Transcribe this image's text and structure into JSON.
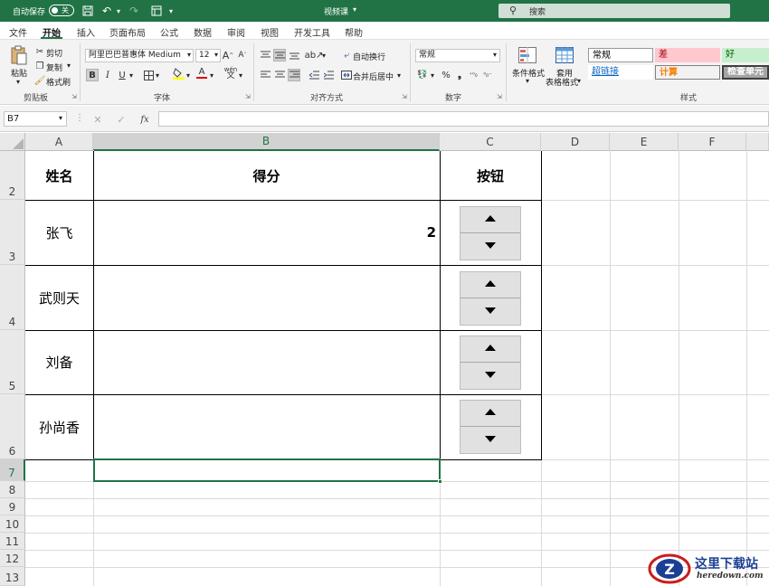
{
  "titlebar": {
    "autosave_label": "自动保存",
    "autosave_state": "关",
    "doc_title": "视频课",
    "search_label": "搜索"
  },
  "tabs": [
    "文件",
    "开始",
    "插入",
    "页面布局",
    "公式",
    "数据",
    "审阅",
    "视图",
    "开发工具",
    "帮助"
  ],
  "active_tab": "开始",
  "ribbon": {
    "clipboard": {
      "paste": "粘贴",
      "cut": "剪切",
      "copy": "复制",
      "format_painter": "格式刷",
      "group": "剪贴板"
    },
    "font": {
      "name": "阿里巴巴普惠体 Medium",
      "size": "12",
      "bold": "B",
      "italic": "I",
      "underline": "U",
      "group": "字体"
    },
    "alignment": {
      "wrap": "自动换行",
      "merge": "合并后居中",
      "group": "对齐方式"
    },
    "number": {
      "format": "常规",
      "group": "数字"
    },
    "styles": {
      "conditional": "条件格式",
      "table_format_1": "套用",
      "table_format_2": "表格格式",
      "group": "样式",
      "normal": "常规",
      "bad": "差",
      "good": "好",
      "hyperlink": "超链接",
      "calc": "计算",
      "check": "检查单元"
    }
  },
  "formula_bar": {
    "name_box": "B7",
    "fx": "fx",
    "value": ""
  },
  "sheet": {
    "columns": [
      "A",
      "B",
      "C",
      "D",
      "E",
      "F"
    ],
    "rows": [
      "2",
      "3",
      "4",
      "5",
      "6",
      "7",
      "8",
      "9",
      "10",
      "11",
      "12",
      "13"
    ],
    "header": {
      "name": "姓名",
      "score": "得分",
      "button": "按钮"
    },
    "data": [
      {
        "name": "张飞",
        "score": "2"
      },
      {
        "name": "武则天",
        "score": ""
      },
      {
        "name": "刘备",
        "score": ""
      },
      {
        "name": "孙尚香",
        "score": ""
      }
    ],
    "selected_cell": "B7"
  },
  "watermark": {
    "brand": "这里下载站",
    "url": "heredown.com"
  },
  "colors": {
    "excel_green": "#217346",
    "grid": "#dadada",
    "header_bg": "#e9e9e9"
  }
}
